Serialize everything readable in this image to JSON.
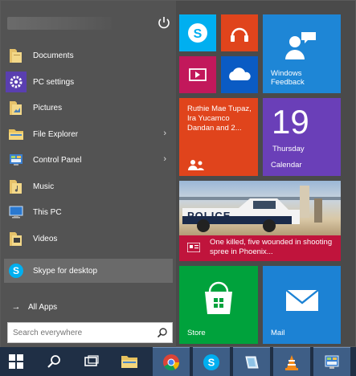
{
  "start_menu": {
    "items": [
      {
        "label": "Documents",
        "icon": "documents-folder-icon"
      },
      {
        "label": "PC settings",
        "icon": "gear-icon"
      },
      {
        "label": "Pictures",
        "icon": "pictures-folder-icon"
      },
      {
        "label": "File Explorer",
        "icon": "file-explorer-icon",
        "chevron": "›"
      },
      {
        "label": "Control Panel",
        "icon": "control-panel-icon",
        "chevron": "›"
      },
      {
        "label": "Music",
        "icon": "music-folder-icon"
      },
      {
        "label": "This PC",
        "icon": "computer-icon"
      },
      {
        "label": "Videos",
        "icon": "videos-folder-icon"
      },
      {
        "label": "Skype for desktop",
        "icon": "skype-icon"
      }
    ],
    "all_apps": "All Apps",
    "all_apps_arrow": "→",
    "search_placeholder": "Search everywhere"
  },
  "tiles": {
    "feedback": "Windows Feedback",
    "people": "Ruthie Mae Tupaz, Ira Yucamco Dandan and 2...",
    "calendar_day": "19",
    "calendar_weekday": "Thursday",
    "calendar_label": "Calendar",
    "news_headline": "One killed, five wounded in shooting spree in Phoenix...",
    "store": "Store",
    "mail": "Mail",
    "news_photo_text": "POLICE"
  },
  "colors": {
    "skype": "#00aff0",
    "music": "#e0441c",
    "feedback": "#1e86d6",
    "video": "#c2185b",
    "onedrive": "#0a5bc4",
    "people": "#e0441c",
    "calendar": "#6a3fb8",
    "news": "#c0143c",
    "store": "#00a23c",
    "mail": "#1c82d4"
  }
}
